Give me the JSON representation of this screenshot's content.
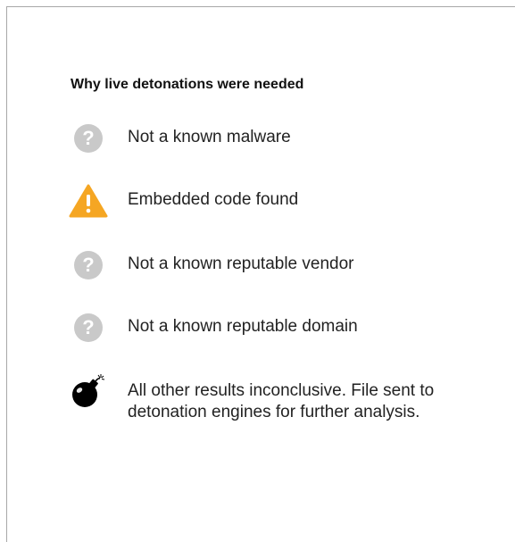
{
  "panel": {
    "heading": "Why live detonations were needed"
  },
  "reasons": [
    {
      "icon": "question-circle-icon",
      "text": "Not a known malware"
    },
    {
      "icon": "warning-triangle-icon",
      "text": "Embedded code found"
    },
    {
      "icon": "question-circle-icon",
      "text": "Not a known reputable vendor"
    },
    {
      "icon": "question-circle-icon",
      "text": "Not a known reputable domain"
    },
    {
      "icon": "bomb-icon",
      "text": "All other results inconclusive. File sent to detonation engines for further analysis."
    }
  ],
  "colors": {
    "question": "#c9c9c9",
    "warning": "#f5a623",
    "bomb": "#000000"
  }
}
